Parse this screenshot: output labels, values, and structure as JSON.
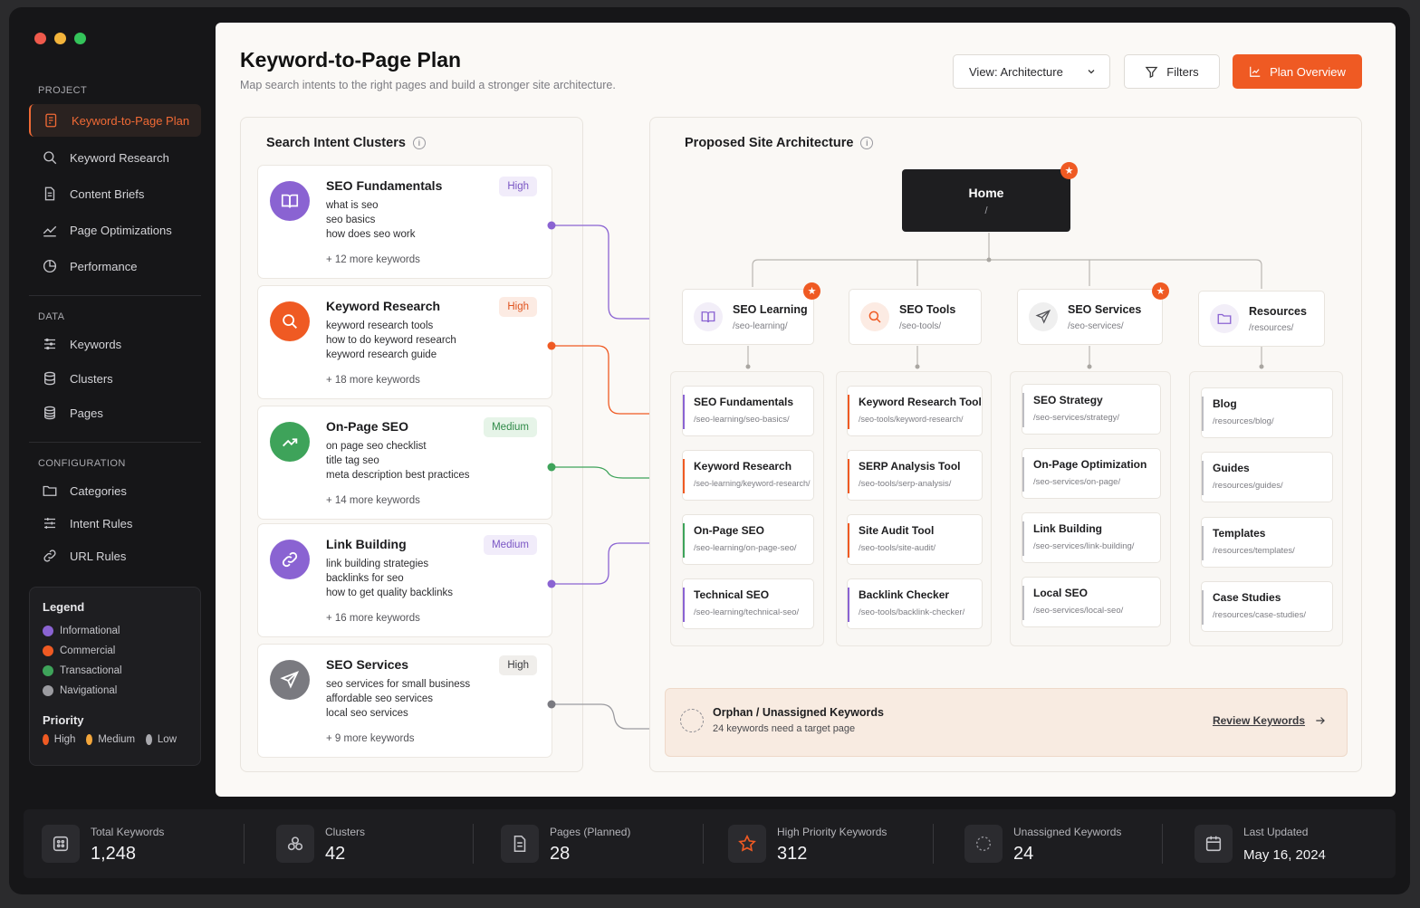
{
  "window": {
    "dots": [
      "#ef5a4c",
      "#f3b43b",
      "#34c45a"
    ]
  },
  "sidebar": {
    "project_label": "PROJECT",
    "project_items": [
      {
        "label": "Keyword-to-Page Plan",
        "icon": "document-edit-icon",
        "active": true
      },
      {
        "label": "Keyword Research",
        "icon": "search-icon"
      },
      {
        "label": "Content Briefs",
        "icon": "document-icon"
      },
      {
        "label": "Page Optimizations",
        "icon": "trend-line-icon"
      },
      {
        "label": "Performance",
        "icon": "pie-clock-icon"
      }
    ],
    "data_label": "DATA",
    "data_items": [
      {
        "label": "Keywords",
        "icon": "list-icon"
      },
      {
        "label": "Clusters",
        "icon": "database-icon"
      },
      {
        "label": "Pages",
        "icon": "stack-icon"
      }
    ],
    "config_label": "CONFIGURATION",
    "config_items": [
      {
        "label": "Categories",
        "icon": "folder-icon"
      },
      {
        "label": "Intent Rules",
        "icon": "sliders-icon"
      },
      {
        "label": "URL Rules",
        "icon": "link-icon"
      }
    ],
    "legend": {
      "title": "Legend",
      "items": [
        {
          "label": "Informational",
          "color": "#8a63d2"
        },
        {
          "label": "Commercial",
          "color": "#ef5a23"
        },
        {
          "label": "Transactional",
          "color": "#3ea35a"
        },
        {
          "label": "Navigational",
          "color": "#9b9ba0"
        }
      ],
      "priority_title": "Priority",
      "priority": [
        {
          "label": "High",
          "color": "#ef5a23"
        },
        {
          "label": "Medium",
          "color": "#f3a63b"
        },
        {
          "label": "Low",
          "color": "#a9a9ae"
        }
      ]
    }
  },
  "header": {
    "title": "Keyword-to-Page Plan",
    "subtitle": "Map search intents to the right pages and build a stronger site architecture.",
    "view_select": "View: Architecture",
    "filters": "Filters",
    "plan_overview": "Plan Overview"
  },
  "clusters_panel": {
    "title": "Search Intent Clusters",
    "clusters": [
      {
        "name": "SEO Fundamentals",
        "priority": "High",
        "keywords": [
          "what is seo",
          "seo basics",
          "how does seo work"
        ],
        "more": "+ 12 more keywords",
        "color": "#8a63d2",
        "icon": "book-icon"
      },
      {
        "name": "Keyword Research",
        "priority": "High",
        "keywords": [
          "keyword research tools",
          "how to do keyword research",
          "keyword research guide"
        ],
        "more": "+ 18 more keywords",
        "color": "#ef5a23",
        "icon": "search-icon"
      },
      {
        "name": "On-Page SEO",
        "priority": "Medium",
        "keywords": [
          "on page seo checklist",
          "title tag seo",
          "meta description best practices"
        ],
        "more": "+ 14 more keywords",
        "color": "#3ea35a",
        "icon": "trend-icon"
      },
      {
        "name": "Link Building",
        "priority": "Medium",
        "keywords": [
          "link building strategies",
          "backlinks for seo",
          "how to get quality backlinks"
        ],
        "more": "+ 16 more keywords",
        "color": "#8a63d2",
        "icon": "link-icon"
      },
      {
        "name": "SEO Services",
        "priority": "High",
        "keywords": [
          "seo services for small business",
          "affordable seo services",
          "local seo services"
        ],
        "more": "+ 9 more keywords",
        "color": "#7a7a80",
        "icon": "send-icon"
      }
    ]
  },
  "architecture_panel": {
    "title": "Proposed Site Architecture",
    "home": {
      "name": "Home",
      "url": "/"
    },
    "sections": [
      {
        "name": "SEO Learning",
        "url": "/seo-learning/",
        "icon": "book-icon",
        "starred": true,
        "color": "#8a63d2",
        "pages": [
          {
            "name": "SEO Fundamentals",
            "url": "/seo-learning/seo-basics/",
            "accent": "#8a63d2"
          },
          {
            "name": "Keyword Research",
            "url": "/seo-learning/keyword-research/",
            "accent": "#ef5a23"
          },
          {
            "name": "On-Page SEO",
            "url": "/seo-learning/on-page-seo/",
            "accent": "#3ea35a"
          },
          {
            "name": "Technical SEO",
            "url": "/seo-learning/technical-seo/",
            "accent": "#8a63d2"
          }
        ]
      },
      {
        "name": "SEO Tools",
        "url": "/seo-tools/",
        "icon": "search-icon",
        "starred": false,
        "color": "#ef5a23",
        "pages": [
          {
            "name": "Keyword Research Tool",
            "url": "/seo-tools/keyword-research/",
            "accent": "#ef5a23"
          },
          {
            "name": "SERP Analysis Tool",
            "url": "/seo-tools/serp-analysis/",
            "accent": "#ef5a23"
          },
          {
            "name": "Site Audit Tool",
            "url": "/seo-tools/site-audit/",
            "accent": "#ef5a23"
          },
          {
            "name": "Backlink Checker",
            "url": "/seo-tools/backlink-checker/",
            "accent": "#8a63d2"
          }
        ]
      },
      {
        "name": "SEO Services",
        "url": "/seo-services/",
        "icon": "send-icon",
        "starred": true,
        "color": "#55555a",
        "pages": [
          {
            "name": "SEO Strategy",
            "url": "/seo-services/strategy/",
            "accent": "#bdbdc2"
          },
          {
            "name": "On-Page Optimization",
            "url": "/seo-services/on-page/",
            "accent": "#bdbdc2"
          },
          {
            "name": "Link Building",
            "url": "/seo-services/link-building/",
            "accent": "#bdbdc2"
          },
          {
            "name": "Local SEO",
            "url": "/seo-services/local-seo/",
            "accent": "#bdbdc2"
          }
        ]
      },
      {
        "name": "Resources",
        "url": "/resources/",
        "icon": "folder-icon",
        "starred": false,
        "color": "#8a63d2",
        "pages": [
          {
            "name": "Blog",
            "url": "/resources/blog/",
            "accent": "#bdbdc2"
          },
          {
            "name": "Guides",
            "url": "/resources/guides/",
            "accent": "#bdbdc2"
          },
          {
            "name": "Templates",
            "url": "/resources/templates/",
            "accent": "#bdbdc2"
          },
          {
            "name": "Case Studies",
            "url": "/resources/case-studies/",
            "accent": "#bdbdc2"
          }
        ]
      }
    ],
    "orphan": {
      "title": "Orphan / Unassigned Keywords",
      "subtitle": "24 keywords need a target page",
      "action": "Review Keywords"
    }
  },
  "stats": [
    {
      "label": "Total Keywords",
      "value": "1,248",
      "icon": "keywords-icon"
    },
    {
      "label": "Clusters",
      "value": "42",
      "icon": "clusters-icon"
    },
    {
      "label": "Pages (Planned)",
      "value": "28",
      "icon": "document-icon"
    },
    {
      "label": "High Priority Keywords",
      "value": "312",
      "icon": "star-icon"
    },
    {
      "label": "Unassigned Keywords",
      "value": "24",
      "icon": "dashed-circle-icon"
    },
    {
      "label": "Last Updated",
      "value": "May 16, 2024",
      "icon": "calendar-icon"
    }
  ]
}
